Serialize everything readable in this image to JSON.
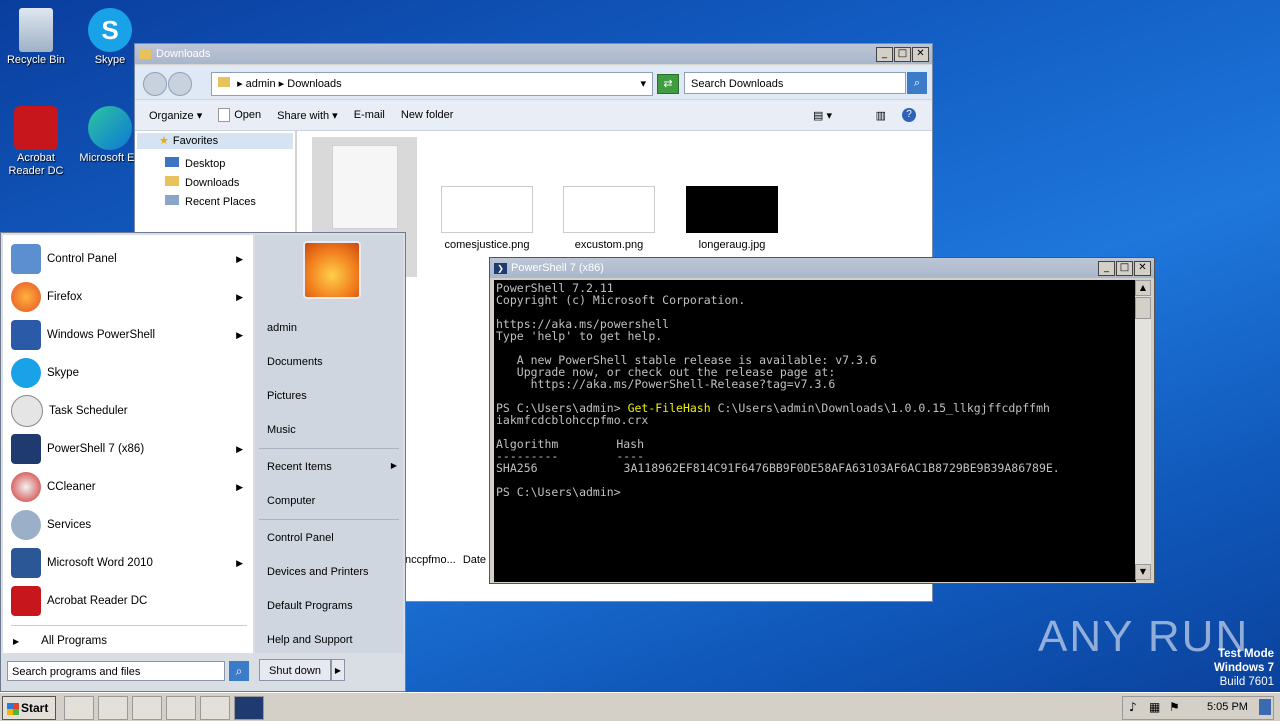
{
  "desktop": {
    "icons": [
      {
        "label": "Recycle Bin"
      },
      {
        "label": "Skype"
      },
      {
        "label": "Acrobat Reader DC"
      },
      {
        "label": "Microsoft Ed"
      }
    ]
  },
  "explorer": {
    "title": "Downloads",
    "breadcrumb": [
      "admin",
      "Downloads"
    ],
    "search_placeholder": "Search Downloads",
    "commands": [
      "Organize",
      "Open",
      "Share with",
      "E-mail",
      "New folder"
    ],
    "nav": {
      "favorites": "Favorites",
      "items": [
        "Desktop",
        "Downloads",
        "Recent Places"
      ]
    },
    "files": [
      {
        "name": "comesjustice.png"
      },
      {
        "name": "excustom.png"
      },
      {
        "name": "longeraug.jpg"
      }
    ],
    "details_fragment": "nccpfmo...",
    "details_date": "Date"
  },
  "powershell": {
    "title": "PowerShell 7 (x86)",
    "lines": [
      "PowerShell 7.2.11",
      "Copyright (c) Microsoft Corporation.",
      "",
      "https://aka.ms/powershell",
      "Type 'help' to get help.",
      "",
      "   A new PowerShell stable release is available: v7.3.6",
      "   Upgrade now, or check out the release page at:",
      "     https://aka.ms/PowerShell-Release?tag=v7.3.6",
      ""
    ],
    "prompt1": "PS C:\\Users\\admin> ",
    "cmd": "Get-FileHash",
    "cmd_args": " C:\\Users\\admin\\Downloads\\1.0.0.15_llkgjffcdpffmh",
    "cmd_wrap": "iakmfcdcblohccpfmo.crx",
    "col_algo": "Algorithm",
    "col_hash": "Hash",
    "dash_algo": "---------",
    "dash_hash": "----",
    "algo": "SHA256",
    "hash": "3A118962EF814C91F6476BB9F0DE58AFA63103AF6AC1B8729BE9B39A86789E.",
    "prompt2": "PS C:\\Users\\admin>"
  },
  "startmenu": {
    "programs": [
      {
        "label": "Control Panel",
        "arrow": "▶"
      },
      {
        "label": "Firefox",
        "arrow": "▶"
      },
      {
        "label": "Windows PowerShell",
        "arrow": "▶"
      },
      {
        "label": "Skype",
        "arrow": ""
      },
      {
        "label": "Task Scheduler",
        "arrow": ""
      },
      {
        "label": "PowerShell 7 (x86)",
        "arrow": "▶"
      },
      {
        "label": "CCleaner",
        "arrow": "▶"
      },
      {
        "label": "Services",
        "arrow": ""
      },
      {
        "label": "Microsoft Word 2010",
        "arrow": "▶"
      },
      {
        "label": "Acrobat Reader DC",
        "arrow": ""
      }
    ],
    "all_programs": "All Programs",
    "search_placeholder": "Search programs and files",
    "right_items": [
      "admin",
      "Documents",
      "Pictures",
      "Music",
      "Recent Items",
      "Computer",
      "Control Panel",
      "Devices and Printers",
      "Default Programs",
      "Help and Support"
    ],
    "shutdown": "Shut down"
  },
  "taskbar": {
    "start": "Start",
    "clock": "5:05 PM"
  },
  "watermark": {
    "brand": "ANY RUN",
    "test_mode": "Test Mode",
    "os": "Windows 7",
    "build": "Build 7601"
  }
}
